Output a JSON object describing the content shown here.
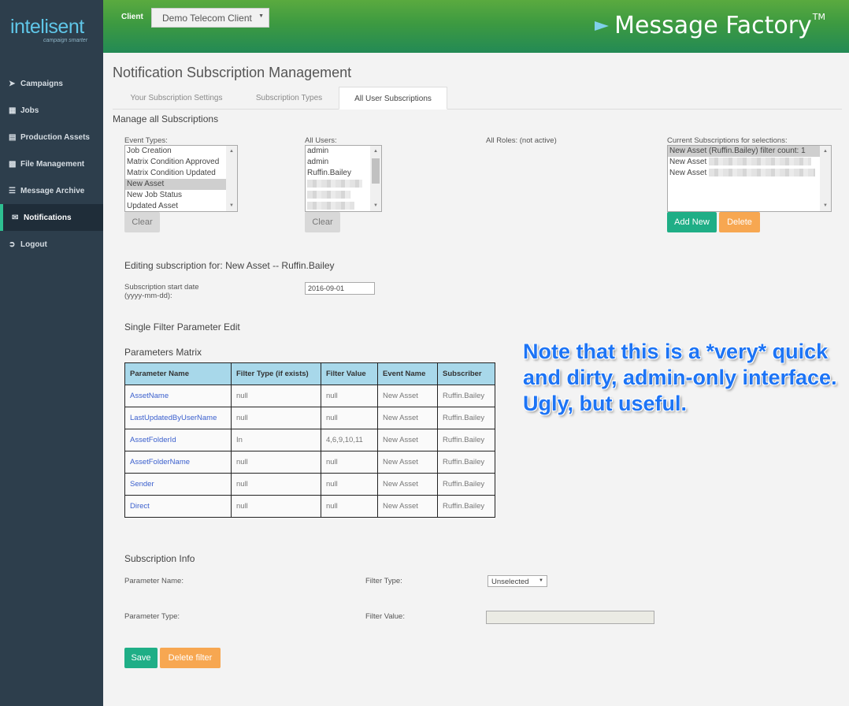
{
  "brand": {
    "logo_text": "inteli",
    "logo_text2": "sent",
    "tagline": "campaign smarter",
    "title": "Message Factory",
    "tm": "TM"
  },
  "header": {
    "client_label": "Client",
    "client_value": "Demo Telecom Client"
  },
  "sidebar": {
    "items": [
      {
        "label": "Campaigns",
        "icon": "paper-plane-icon"
      },
      {
        "label": "Jobs",
        "icon": "grid-icon"
      },
      {
        "label": "Production Assets",
        "icon": "document-icon"
      },
      {
        "label": "File Management",
        "icon": "file-icon"
      },
      {
        "label": "Message Archive",
        "icon": "database-icon"
      },
      {
        "label": "Notifications",
        "icon": "envelope-icon"
      },
      {
        "label": "Logout",
        "icon": "logout-icon"
      }
    ],
    "active": "Notifications"
  },
  "page": {
    "title": "Notification Subscription Management",
    "tabs": [
      "Your Subscription Settings",
      "Subscription Types",
      "All User Subscriptions"
    ],
    "active_tab": "All User Subscriptions",
    "section_title": "Manage all Subscriptions"
  },
  "selectors": {
    "event_types_label": "Event Types:",
    "event_types": [
      "Job Creation",
      "Matrix Condition Approved",
      "Matrix Condition Updated",
      "New Asset",
      "New Job Status",
      "Updated Asset"
    ],
    "event_selected": "New Asset",
    "users_label": "All Users:",
    "users": [
      "admin",
      "admin",
      "Ruffin.Bailey"
    ],
    "roles_label": "All Roles: (not active)",
    "current_label": "Current Subscriptions for selections:",
    "current": [
      "New Asset (Ruffin.Bailey) filter count: 1",
      "New Asset",
      "New Asset"
    ],
    "clear_label": "Clear",
    "add_new_label": "Add New",
    "delete_label": "Delete"
  },
  "editing": {
    "heading": "Editing subscription for: New Asset -- Ruffin.Bailey",
    "start_date_label_1": "Subscription start date",
    "start_date_label_2": "(yyyy-mm-dd):",
    "start_date_value": "2016-09-01",
    "single_filter_heading": "Single Filter Parameter Edit",
    "matrix_heading": "Parameters Matrix"
  },
  "matrix": {
    "headers": [
      "Parameter Name",
      "Filter Type (if exists)",
      "Filter Value",
      "Event Name",
      "Subscriber"
    ],
    "rows": [
      [
        "AssetName",
        "null",
        "null",
        "New Asset",
        "Ruffin.Bailey"
      ],
      [
        "LastUpdatedByUserName",
        "null",
        "null",
        "New Asset",
        "Ruffin.Bailey"
      ],
      [
        "AssetFolderId",
        "In",
        "4,6,9,10,11",
        "New Asset",
        "Ruffin.Bailey"
      ],
      [
        "AssetFolderName",
        "null",
        "null",
        "New Asset",
        "Ruffin.Bailey"
      ],
      [
        "Sender",
        "null",
        "null",
        "New Asset",
        "Ruffin.Bailey"
      ],
      [
        "Direct",
        "null",
        "null",
        "New Asset",
        "Ruffin.Bailey"
      ]
    ]
  },
  "note": "Note that this is a *very* quick and dirty, admin-only interface. Ugly, but useful.",
  "info": {
    "heading": "Subscription Info",
    "param_name_label": "Parameter Name:",
    "param_type_label": "Parameter Type:",
    "filter_type_label": "Filter Type:",
    "filter_type_value": "Unselected",
    "filter_value_label": "Filter Value:",
    "filter_value": "",
    "save_label": "Save",
    "delete_filter_label": "Delete filter"
  },
  "colors": {
    "sidebar": "#2d3e4c",
    "accent": "#1fae86",
    "warning": "#f7a751",
    "table_header": "#a8d8ea",
    "note": "#1d74f5"
  }
}
